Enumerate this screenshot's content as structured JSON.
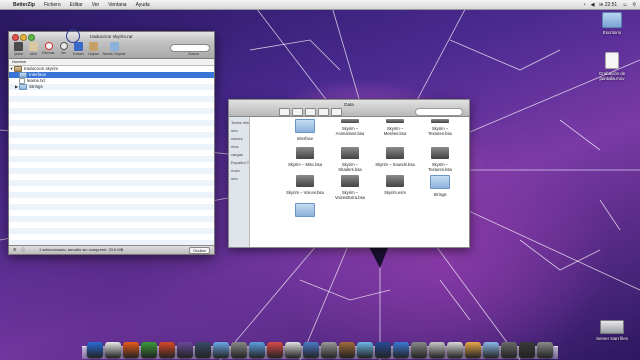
{
  "menubar": {
    "app": "BetterZip",
    "items": [
      "Fichero",
      "Editar",
      "Ver",
      "Ventana",
      "Ayuda"
    ],
    "clock": "ie 22:51"
  },
  "desktop_icons": [
    {
      "label": "Escritorio"
    },
    {
      "label": "Grabación de pantalla.mov"
    },
    {
      "label": "Server start files"
    }
  ],
  "betterzip": {
    "title": "traduccion skyrim.rar",
    "toolbar": [
      "Quitar",
      "Abrir",
      "Eliminar",
      "Ver",
      "Extraer",
      "Limpiar",
      "Nueva Carpeta"
    ],
    "search_label": "Buscar",
    "column_name": "Nombre",
    "tree": [
      {
        "label": "traduccion skyrim",
        "indent": 0,
        "expanded": true
      },
      {
        "label": "Interface",
        "indent": 1,
        "selected": true
      },
      {
        "label": "leame.txt",
        "indent": 1
      },
      {
        "label": "Strings",
        "indent": 1,
        "expanded": false
      }
    ],
    "status": "1 seleccionado, tamaño sin comprimir: 33.6 MB",
    "hide_button": "Ocultar"
  },
  "finder": {
    "title": "Data",
    "sidebar": [
      "Todos mis archivos",
      "nes",
      "ciones",
      "ntos",
      "cargas",
      "Español-Te...",
      "nosh",
      "nes"
    ],
    "items": [
      {
        "label": "Interface",
        "kind": "folder"
      },
      {
        "label": "Skyrim – Animations.bsa",
        "kind": "file"
      },
      {
        "label": "Skyrim – Meshes.bsa",
        "kind": "file"
      },
      {
        "label": "Skyrim – Textures.bsa",
        "kind": "file"
      },
      {
        "label": "Skyrim – Misc.bsa",
        "kind": "file"
      },
      {
        "label": "Skyrim – Shaders.bsa",
        "kind": "file"
      },
      {
        "label": "Skyrim – Sounds.bsa",
        "kind": "file"
      },
      {
        "label": "Skyrim – Textures.bsa",
        "kind": "file"
      },
      {
        "label": "Skyrim – Voices.bsa",
        "kind": "file"
      },
      {
        "label": "Skyrim – VoicesExtra.bsa",
        "kind": "file"
      },
      {
        "label": "Skyrim.esm",
        "kind": "file"
      },
      {
        "label": "Strings",
        "kind": "folder"
      },
      {
        "label": "",
        "kind": "folder"
      }
    ]
  },
  "dock": {
    "colors": [
      "#2a6ad8",
      "#e8e8e8",
      "#e85a1a",
      "#3a9a3a",
      "#d84a2a",
      "#6a4a9a",
      "#3a4a6a",
      "#6aa8e8",
      "#888888",
      "#5aa0e0",
      "#d84a4a",
      "#e0e0e0",
      "#4a7ac8",
      "#9a9a9a",
      "#a06a3a",
      "#6ab8e8",
      "#2a4a9a",
      "#3a7ad8",
      "#8a8a8a",
      "#c8c8c8",
      "#d8d8d8",
      "#e8a84a",
      "#8ab8e8",
      "#6a6a6a",
      "#3a3a3a",
      "#8a8a8a"
    ]
  }
}
